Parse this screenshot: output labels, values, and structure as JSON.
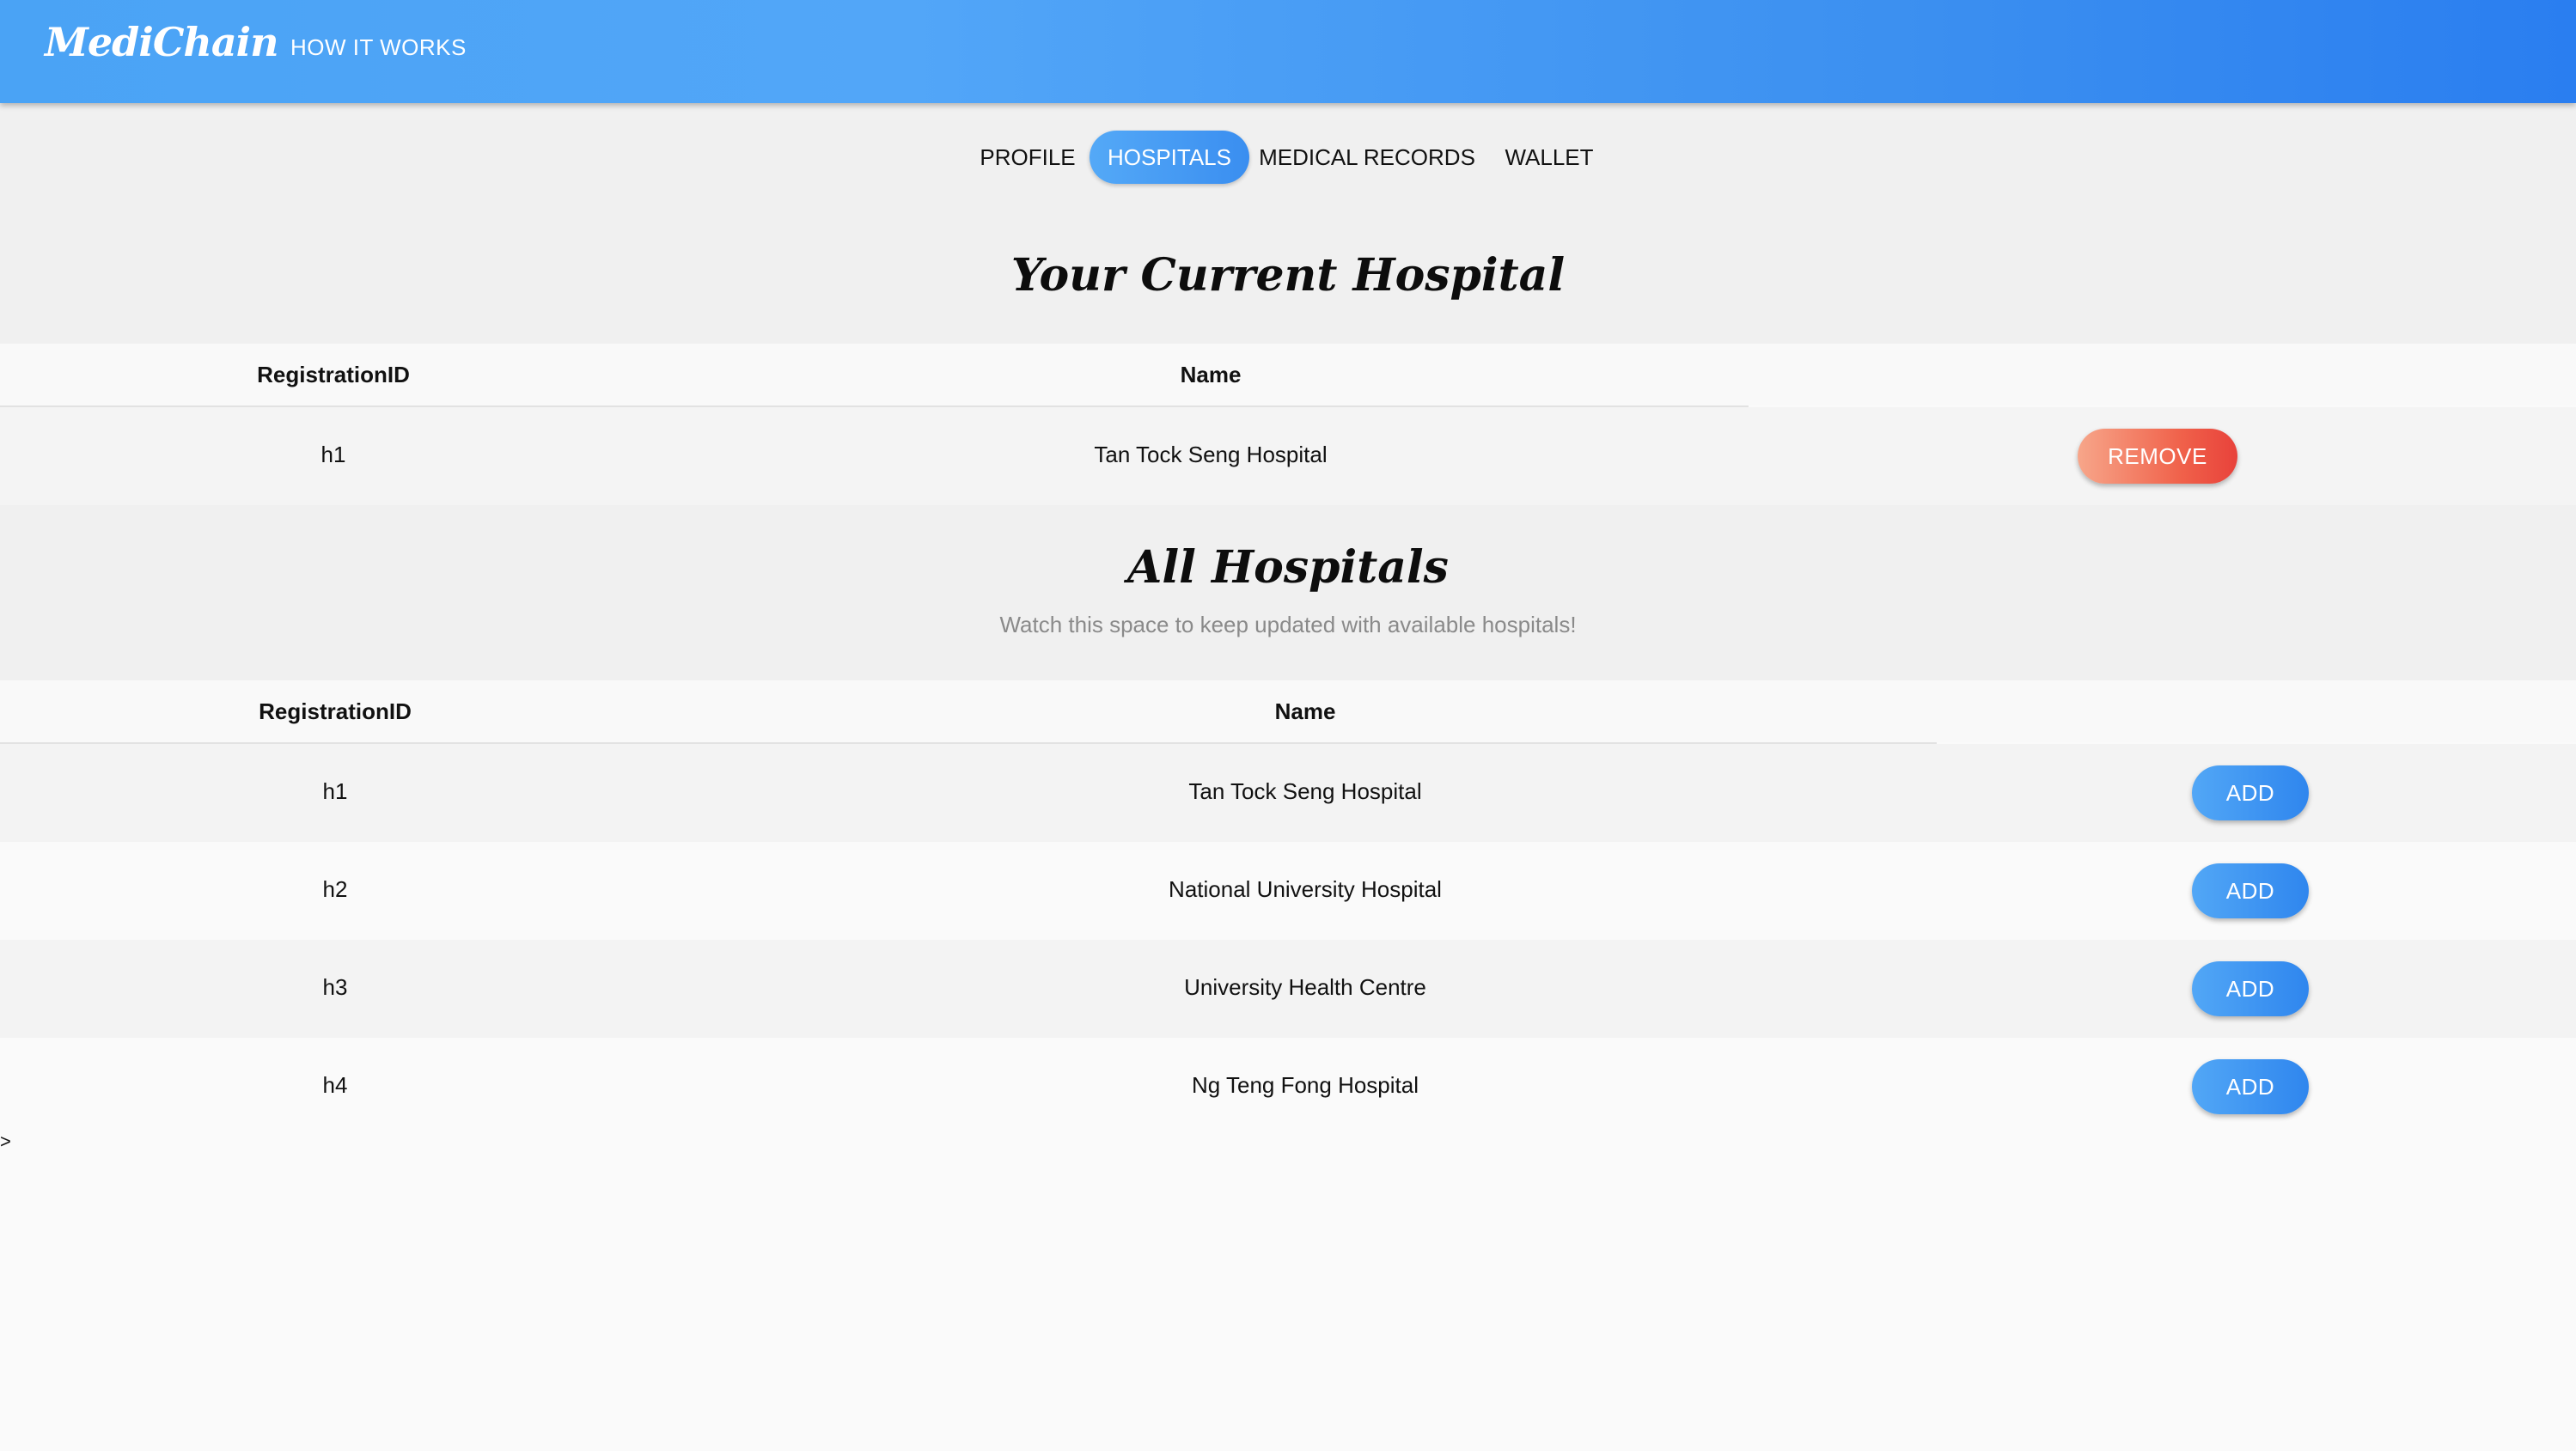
{
  "header": {
    "brand": "MediChain",
    "nav_link": "HOW IT WORKS"
  },
  "tabs": [
    {
      "label": "PROFILE",
      "active": false
    },
    {
      "label": "HOSPITALS",
      "active": true
    },
    {
      "label": "MEDICAL RECORDS",
      "active": false
    },
    {
      "label": "WALLET",
      "active": false
    }
  ],
  "current_hospital": {
    "title": "Your Current Hospital",
    "columns": [
      "RegistrationID",
      "Name"
    ],
    "row": {
      "id": "h1",
      "name": "Tan Tock Seng Hospital",
      "action": "REMOVE"
    }
  },
  "all_hospitals": {
    "title": "All Hospitals",
    "subtitle": "Watch this space to keep updated with available hospitals!",
    "columns": [
      "RegistrationID",
      "Name"
    ],
    "rows": [
      {
        "id": "h1",
        "name": "Tan Tock Seng Hospital",
        "action": "ADD"
      },
      {
        "id": "h2",
        "name": "National University Hospital",
        "action": "ADD"
      },
      {
        "id": "h3",
        "name": "University Health Centre",
        "action": "ADD"
      },
      {
        "id": "h4",
        "name": "Ng Teng Fong Hospital",
        "action": "ADD"
      }
    ]
  },
  "stray_text": ">",
  "colors": {
    "header_gradient_start": "#4aa3f5",
    "header_gradient_end": "#2a7ef0",
    "active_tab": "#3a8ef0",
    "remove_button": "#f0614a",
    "add_button": "#2f86ee"
  }
}
